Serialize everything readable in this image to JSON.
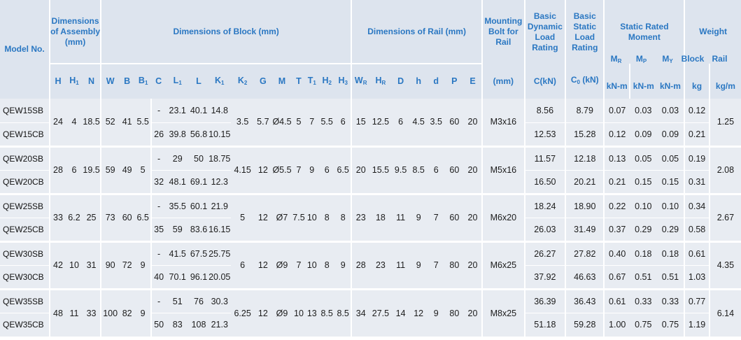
{
  "header": {
    "model_no": "Model No.",
    "dim_assembly": "Dimensions of Assembly (mm)",
    "dim_block": "Dimensions of Block (mm)",
    "dim_rail": "Dimensions of Rail (mm)",
    "mounting_bolt": "Mounting Bolt for Rail",
    "basic_dynamic": "Basic Dynamic Load Rating",
    "basic_static": "Basic Static Load Rating",
    "static_moment": "Static Rated Moment",
    "weight": "Weight",
    "mr": "M",
    "mr_sub": "R",
    "mp": "M",
    "mp_sub": "P",
    "my": "M",
    "my_sub": "Y",
    "block": "Block",
    "rail": "Rail",
    "cols": [
      {
        "t": "H",
        "s": ""
      },
      {
        "t": "H",
        "s": "1"
      },
      {
        "t": "N",
        "s": ""
      },
      {
        "t": "W",
        "s": ""
      },
      {
        "t": "B",
        "s": ""
      },
      {
        "t": "B",
        "s": "1"
      },
      {
        "t": "C",
        "s": ""
      },
      {
        "t": "L",
        "s": "1"
      },
      {
        "t": "L",
        "s": ""
      },
      {
        "t": "K",
        "s": "1"
      },
      {
        "t": "K",
        "s": "2"
      },
      {
        "t": "G",
        "s": ""
      },
      {
        "t": "M",
        "s": ""
      },
      {
        "t": "T",
        "s": ""
      },
      {
        "t": "T",
        "s": "1"
      },
      {
        "t": "H",
        "s": "2"
      },
      {
        "t": "H",
        "s": "3"
      },
      {
        "t": "W",
        "s": "R"
      },
      {
        "t": "H",
        "s": "R"
      },
      {
        "t": "D",
        "s": ""
      },
      {
        "t": "h",
        "s": ""
      },
      {
        "t": "d",
        "s": ""
      },
      {
        "t": "P",
        "s": ""
      },
      {
        "t": "E",
        "s": ""
      },
      {
        "t": "(mm)",
        "s": ""
      },
      {
        "t": "C(kN)",
        "s": ""
      },
      {
        "t": "C",
        "s": "0",
        "after": " (kN)"
      },
      {
        "t": "kN-m",
        "s": ""
      },
      {
        "t": "kN-m",
        "s": ""
      },
      {
        "t": "kN-m",
        "s": ""
      },
      {
        "t": "kg",
        "s": ""
      },
      {
        "t": "kg/m",
        "s": ""
      }
    ]
  },
  "groups": [
    {
      "shared": {
        "H": "24",
        "H1": "4",
        "N": "18.5",
        "W": "52",
        "B": "41",
        "B1": "5.5",
        "K2": "3.5",
        "G": "5.7",
        "M": "Ø4.5",
        "T": "5",
        "T1": "7",
        "H2": "5.5",
        "H3": "6",
        "WR": "15",
        "HR": "12.5",
        "D": "6",
        "h": "4.5",
        "d": "3.5",
        "P": "60",
        "E": "20",
        "bolt": "M3x16",
        "rail_kg": "1.25"
      },
      "rows": [
        {
          "model": "QEW15SB",
          "C": "-",
          "L1": "23.1",
          "L": "40.1",
          "K1": "14.8",
          "Cdyn": "8.56",
          "C0": "8.79",
          "MR": "0.07",
          "MP": "0.03",
          "MY": "0.03",
          "block_kg": "0.12"
        },
        {
          "model": "QEW15CB",
          "C": "26",
          "L1": "39.8",
          "L": "56.8",
          "K1": "10.15",
          "Cdyn": "12.53",
          "C0": "15.28",
          "MR": "0.12",
          "MP": "0.09",
          "MY": "0.09",
          "block_kg": "0.21"
        }
      ]
    },
    {
      "shared": {
        "H": "28",
        "H1": "6",
        "N": "19.5",
        "W": "59",
        "B": "49",
        "B1": "5",
        "K2": "4.15",
        "G": "12",
        "M": "Ø5.5",
        "T": "7",
        "T1": "9",
        "H2": "6",
        "H3": "6.5",
        "WR": "20",
        "HR": "15.5",
        "D": "9.5",
        "h": "8.5",
        "d": "6",
        "P": "60",
        "E": "20",
        "bolt": "M5x16",
        "rail_kg": "2.08"
      },
      "rows": [
        {
          "model": "QEW20SB",
          "C": "-",
          "L1": "29",
          "L": "50",
          "K1": "18.75",
          "Cdyn": "11.57",
          "C0": "12.18",
          "MR": "0.13",
          "MP": "0.05",
          "MY": "0.05",
          "block_kg": "0.19"
        },
        {
          "model": "QEW20CB",
          "C": "32",
          "L1": "48.1",
          "L": "69.1",
          "K1": "12.3",
          "Cdyn": "16.50",
          "C0": "20.21",
          "MR": "0.21",
          "MP": "0.15",
          "MY": "0.15",
          "block_kg": "0.31"
        }
      ]
    },
    {
      "shared": {
        "H": "33",
        "H1": "6.2",
        "N": "25",
        "W": "73",
        "B": "60",
        "B1": "6.5",
        "K2": "5",
        "G": "12",
        "M": "Ø7",
        "T": "7.5",
        "T1": "10",
        "H2": "8",
        "H3": "8",
        "WR": "23",
        "HR": "18",
        "D": "11",
        "h": "9",
        "d": "7",
        "P": "60",
        "E": "20",
        "bolt": "M6x20",
        "rail_kg": "2.67"
      },
      "rows": [
        {
          "model": "QEW25SB",
          "C": "-",
          "L1": "35.5",
          "L": "60.1",
          "K1": "21.9",
          "Cdyn": "18.24",
          "C0": "18.90",
          "MR": "0.22",
          "MP": "0.10",
          "MY": "0.10",
          "block_kg": "0.34"
        },
        {
          "model": "QEW25CB",
          "C": "35",
          "L1": "59",
          "L": "83.6",
          "K1": "16.15",
          "Cdyn": "26.03",
          "C0": "31.49",
          "MR": "0.37",
          "MP": "0.29",
          "MY": "0.29",
          "block_kg": "0.58"
        }
      ]
    },
    {
      "shared": {
        "H": "42",
        "H1": "10",
        "N": "31",
        "W": "90",
        "B": "72",
        "B1": "9",
        "K2": "6",
        "G": "12",
        "M": "Ø9",
        "T": "7",
        "T1": "10",
        "H2": "8",
        "H3": "9",
        "WR": "28",
        "HR": "23",
        "D": "11",
        "h": "9",
        "d": "7",
        "P": "80",
        "E": "20",
        "bolt": "M6x25",
        "rail_kg": "4.35"
      },
      "rows": [
        {
          "model": "QEW30SB",
          "C": "-",
          "L1": "41.5",
          "L": "67.5",
          "K1": "25.75",
          "Cdyn": "26.27",
          "C0": "27.82",
          "MR": "0.40",
          "MP": "0.18",
          "MY": "0.18",
          "block_kg": "0.61"
        },
        {
          "model": "QEW30CB",
          "C": "40",
          "L1": "70.1",
          "L": "96.1",
          "K1": "20.05",
          "Cdyn": "37.92",
          "C0": "46.63",
          "MR": "0.67",
          "MP": "0.51",
          "MY": "0.51",
          "block_kg": "1.03"
        }
      ]
    },
    {
      "shared": {
        "H": "48",
        "H1": "11",
        "N": "33",
        "W": "100",
        "B": "82",
        "B1": "9",
        "K2": "6.25",
        "G": "12",
        "M": "Ø9",
        "T": "10",
        "T1": "13",
        "H2": "8.5",
        "H3": "8.5",
        "WR": "34",
        "HR": "27.5",
        "D": "14",
        "h": "12",
        "d": "9",
        "P": "80",
        "E": "20",
        "bolt": "M8x25",
        "rail_kg": "6.14"
      },
      "rows": [
        {
          "model": "QEW35SB",
          "C": "-",
          "L1": "51",
          "L": "76",
          "K1": "30.3",
          "Cdyn": "36.39",
          "C0": "36.43",
          "MR": "0.61",
          "MP": "0.33",
          "MY": "0.33",
          "block_kg": "0.77"
        },
        {
          "model": "QEW35CB",
          "C": "50",
          "L1": "83",
          "L": "108",
          "K1": "21.3",
          "Cdyn": "51.18",
          "C0": "59.28",
          "MR": "1.00",
          "MP": "0.75",
          "MY": "0.75",
          "block_kg": "1.19"
        }
      ]
    }
  ]
}
